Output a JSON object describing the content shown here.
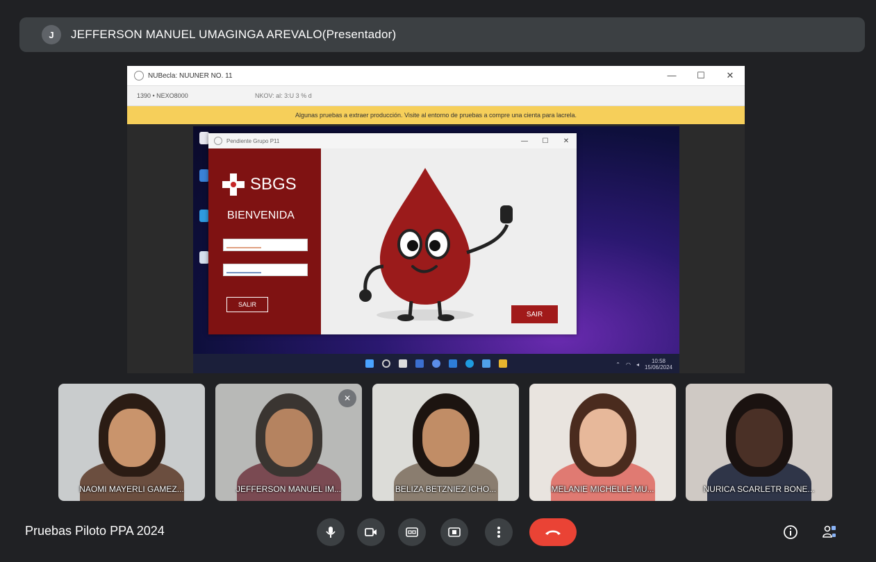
{
  "presenter": {
    "initial": "J",
    "name": "JEFFERSON MANUEL UMAGINGA AREVALO(Presentador)"
  },
  "shared_window": {
    "title": "NUBecla: NUUNER NO. 11",
    "address_left": "1390 • NEXO8000",
    "address_right": "NKOV: al: 3:U 3 % d",
    "warning": "Algunas pruebas a extraer producción. Visite al entorno de pruebas a compre una cienta para lacrela.",
    "controls": {
      "minimize": "—",
      "maximize": "☐",
      "close": "✕"
    }
  },
  "app": {
    "title": "Pendiente Grupo P11",
    "logo_text": "SBGS",
    "welcome": "BIENVENIDA",
    "left_button": "SALIR",
    "right_button": "SAIR",
    "controls": {
      "minimize": "—",
      "maximize": "☐",
      "close": "✕"
    }
  },
  "taskbar": {
    "time": "10:58",
    "date": "15/06/2024"
  },
  "participants": [
    {
      "name": "NAOMI MAYERLI GAMEZ...",
      "bg": "#c9cccd",
      "skin": "#c9946c",
      "hair": "#2b1c14",
      "shirt": "#6b4e3f"
    },
    {
      "name": "JEFFERSON MANUEL IM...",
      "bg": "#b8b9b7",
      "skin": "#b58360",
      "hair": "#3a3531",
      "shirt": "#7a4a52"
    },
    {
      "name": "BELIZA BETZNIEZ ICHO...",
      "bg": "#dcdcd8",
      "skin": "#c18d66",
      "hair": "#1c1410",
      "shirt": "#8a7d6f"
    },
    {
      "name": "MELANIE MICHELLE MU...",
      "bg": "#e9e4df",
      "skin": "#e7b89a",
      "hair": "#4a2b1e",
      "shirt": "#e07a72"
    },
    {
      "name": "NURICA SCARLETR BONE...",
      "bg": "#cfc9c4",
      "skin": "#4a3026",
      "hair": "#1a1210",
      "shirt": "#2f3548"
    }
  ],
  "meeting": {
    "title": "Pruebas Piloto PPA 2024"
  },
  "icons": {
    "mic": "mic-icon",
    "camera": "camera-icon",
    "captions": "captions-icon",
    "present": "present-icon",
    "more": "more-icon",
    "end_call": "end-call-icon",
    "info": "info-icon",
    "people": "people-icon"
  },
  "colors": {
    "end_call": "#ea4335",
    "warning": "#f6cf5a",
    "brand_red": "#7f1212"
  }
}
